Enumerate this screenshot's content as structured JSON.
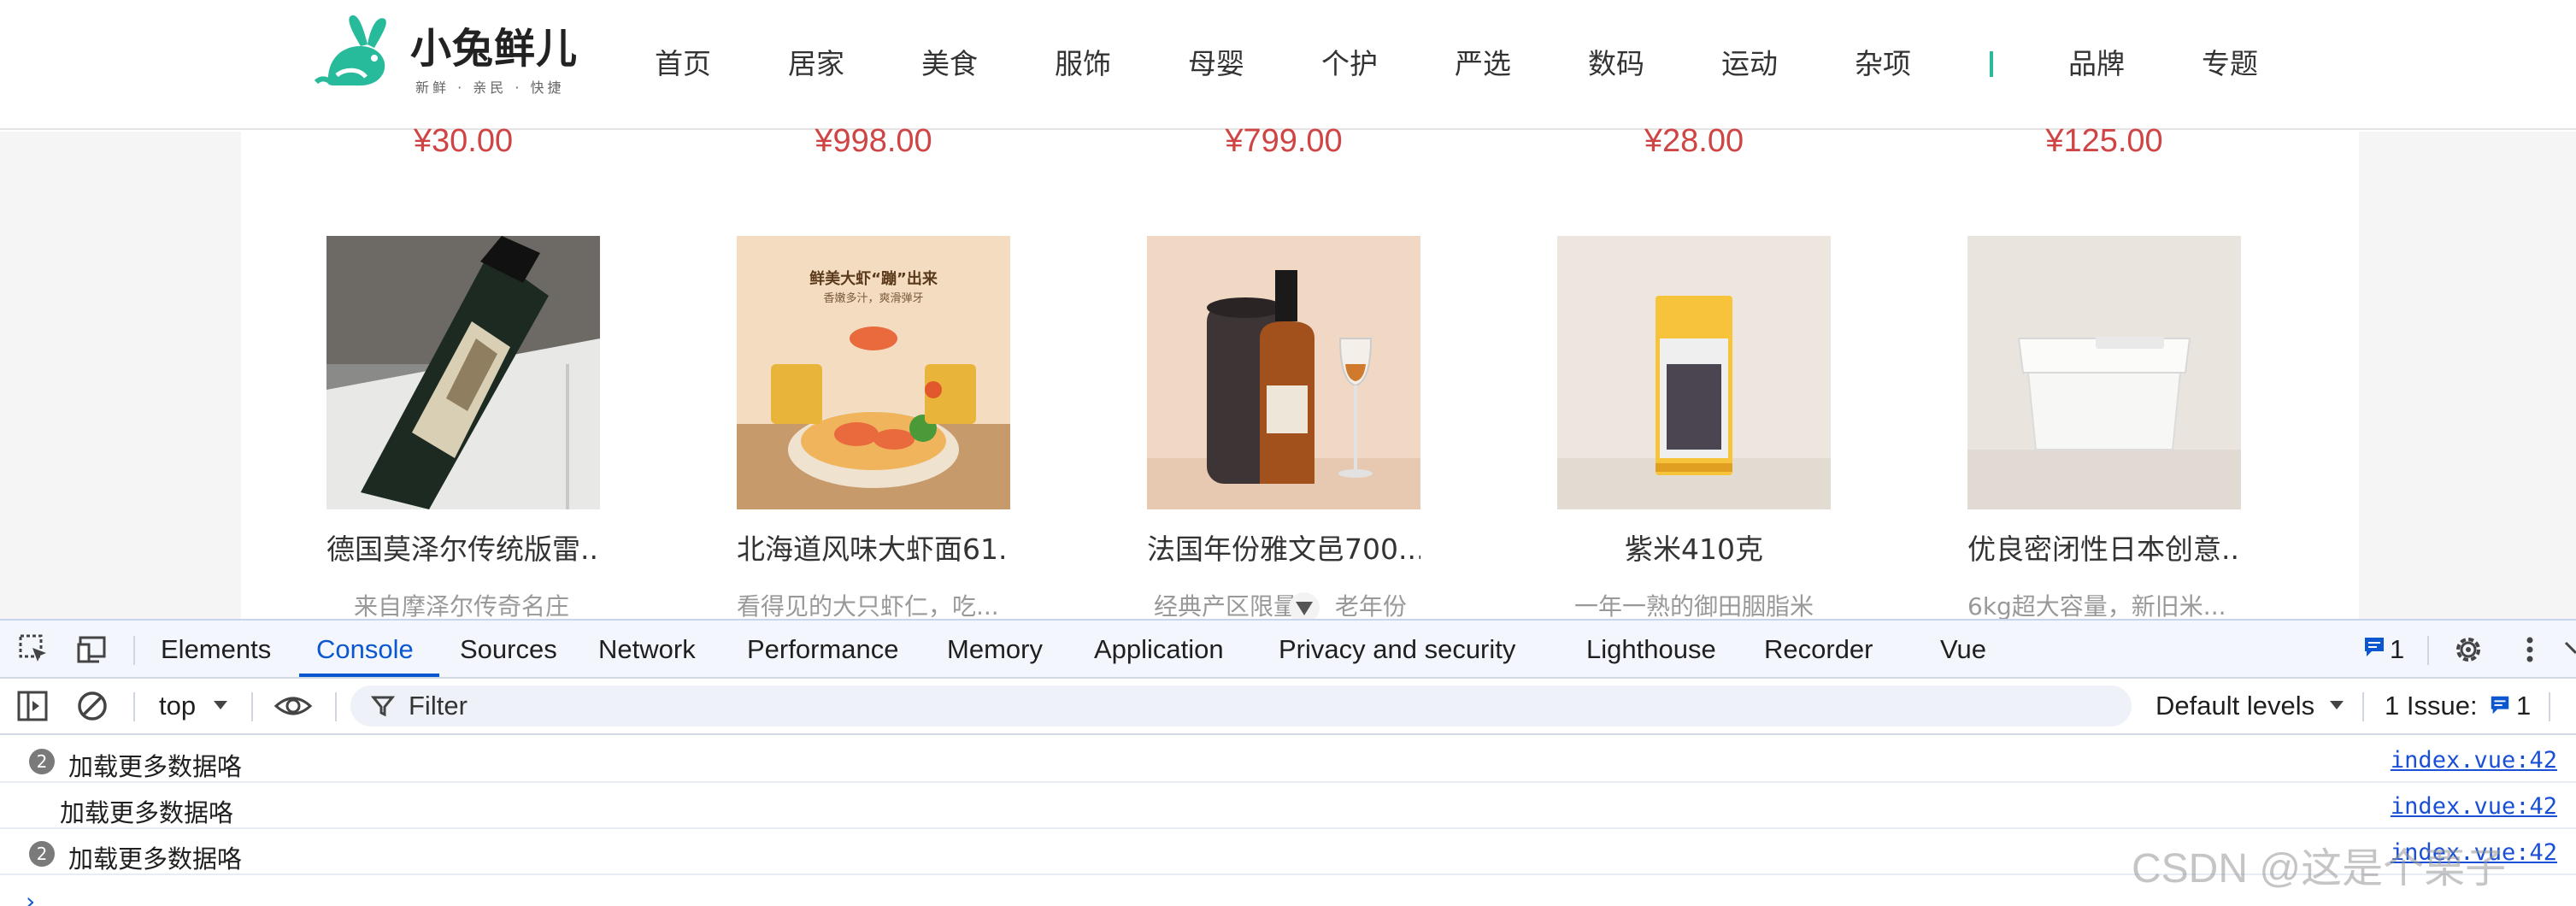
{
  "header": {
    "logo": {
      "name": "小兔鲜儿",
      "slogan": "新鲜 · 亲民 · 快捷"
    },
    "nav_items": [
      "首页",
      "居家",
      "美食",
      "服饰",
      "母婴",
      "个护",
      "严选",
      "数码",
      "运动",
      "杂项"
    ],
    "nav_items_after_divider": [
      "品牌",
      "专题"
    ]
  },
  "prices_row": [
    "¥30.00",
    "¥998.00",
    "¥799.00",
    "¥28.00",
    "¥125.00"
  ],
  "products": [
    {
      "name": "德国莫泽尔传统版雷...",
      "desc": "来自摩泽尔传奇名庄"
    },
    {
      "name": "北海道风味大虾面61...",
      "desc": "看得见的大只虾仁，吃...",
      "image_text": "鲜美大虾“蹦”出来",
      "image_subtext": "香嫩多汁，爽滑弹牙"
    },
    {
      "name": "法国年份雅文邑700...",
      "desc": "经典产区限量",
      "desc_tail": "老年份"
    },
    {
      "name": "紫米410克",
      "desc": "一年一熟的御田胭脂米"
    },
    {
      "name": "优良密闭性日本创意...",
      "desc": "6kg超大容量，新旧米..."
    }
  ],
  "devtools": {
    "tabs": [
      "Elements",
      "Console",
      "Sources",
      "Network",
      "Performance",
      "Memory",
      "Application",
      "Privacy and security",
      "Lighthouse",
      "Recorder",
      "Vue"
    ],
    "active_tab": "Console",
    "issue_badge_count": "1",
    "toolbar": {
      "context": "top",
      "filter_placeholder": "Filter",
      "levels": "Default levels",
      "issues_label": "1 Issue:",
      "issues_count": "1"
    },
    "console_messages": [
      {
        "count": "2",
        "text": "加载更多数据咯",
        "source": "index.vue:42"
      },
      {
        "count": "",
        "text": "加载更多数据咯",
        "source": "index.vue:42"
      },
      {
        "count": "2",
        "text": "加载更多数据咯",
        "source": "index.vue:42"
      }
    ],
    "prompt": "›"
  },
  "watermark": "CSDN @这是个栗子"
}
